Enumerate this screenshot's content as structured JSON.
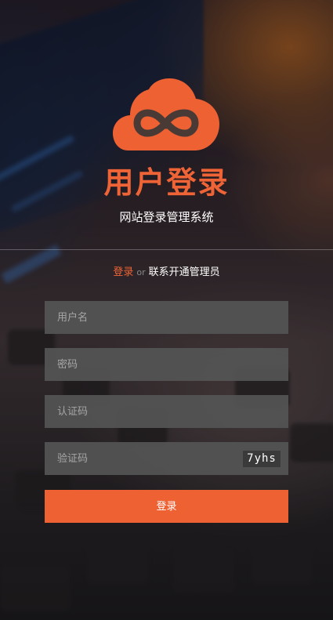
{
  "header": {
    "title": "用户登录",
    "subtitle": "网站登录管理系统",
    "logo_icon": "cloud-infinity-icon"
  },
  "auth_links": {
    "login": "登录",
    "separator": "or",
    "contact": "联系开通管理员"
  },
  "form": {
    "username_placeholder": "用户名",
    "password_placeholder": "密码",
    "auth_code_placeholder": "认证码",
    "verify_code_placeholder": "验证码",
    "captcha_text": "7yhs",
    "submit_label": "登录"
  },
  "colors": {
    "accent": "#ee6436",
    "field_bg": "#555555",
    "text": "#ffffff"
  }
}
